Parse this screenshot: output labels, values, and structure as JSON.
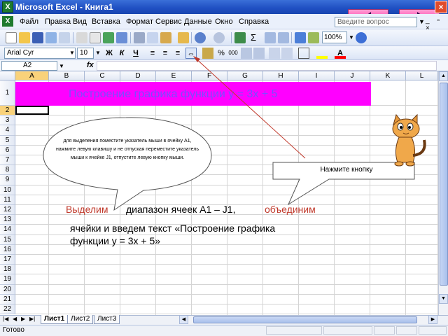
{
  "window": {
    "app_icon_letter": "X",
    "title": "Microsoft Excel - Книга1",
    "close_glyph": "×"
  },
  "menu": {
    "icon_letter": "X",
    "items": [
      "Файл",
      "Правка",
      "Вид",
      "Вставка",
      "Формат",
      "Сервис",
      "Данные",
      "Окно",
      "Справка"
    ],
    "question_placeholder": "Введите вопрос",
    "doc_controls": "_ ▫ ×"
  },
  "toolbar": {
    "zoom": "100%",
    "font_name": "Arial Cyr",
    "font_size": "10",
    "bold": "Ж",
    "italic": "К",
    "underline": "Ч",
    "percent": "%",
    "thousands": "000",
    "accent_color": "#ff0000",
    "highlight_color": "#ffff00"
  },
  "formula_bar": {
    "name_box": "A2",
    "fx": "fx"
  },
  "grid": {
    "columns": [
      "A",
      "B",
      "C",
      "D",
      "E",
      "F",
      "G",
      "H",
      "I",
      "J",
      "K",
      "L"
    ],
    "rows": [
      "1",
      "2",
      "3",
      "4",
      "5",
      "6",
      "7",
      "8",
      "9",
      "10",
      "11",
      "12",
      "13",
      "14",
      "15",
      "16",
      "17",
      "18",
      "19",
      "20",
      "21",
      "22"
    ],
    "selected_column": "A",
    "selected_row": "2",
    "title_cell_text": "Построение графика функции y = 3x + 5",
    "title_fill": "#ff00ff"
  },
  "sheets": {
    "tabs": [
      "Лист1",
      "Лист2",
      "Лист3"
    ],
    "active": "Лист1"
  },
  "status": {
    "text": "Готово"
  },
  "annotations": {
    "bubble_text": "для выделения поместите указатель мыши в ячейку А1, нажмите левую клавишу и не отпуская переместите указатель мыши к ячейке J1, отпустите левую кнопку мыши.",
    "button_hint": "Нажмите кнопку",
    "instruction_select": "Выделим",
    "instruction_range": "диапазон ячеек  A1 – J1,",
    "instruction_merge": "объединим",
    "instruction_line2": "ячейки и введем текст «Построение графика",
    "instruction_line3": "функции y = 3x + 5»",
    "highlight_color": "#c0392b"
  }
}
